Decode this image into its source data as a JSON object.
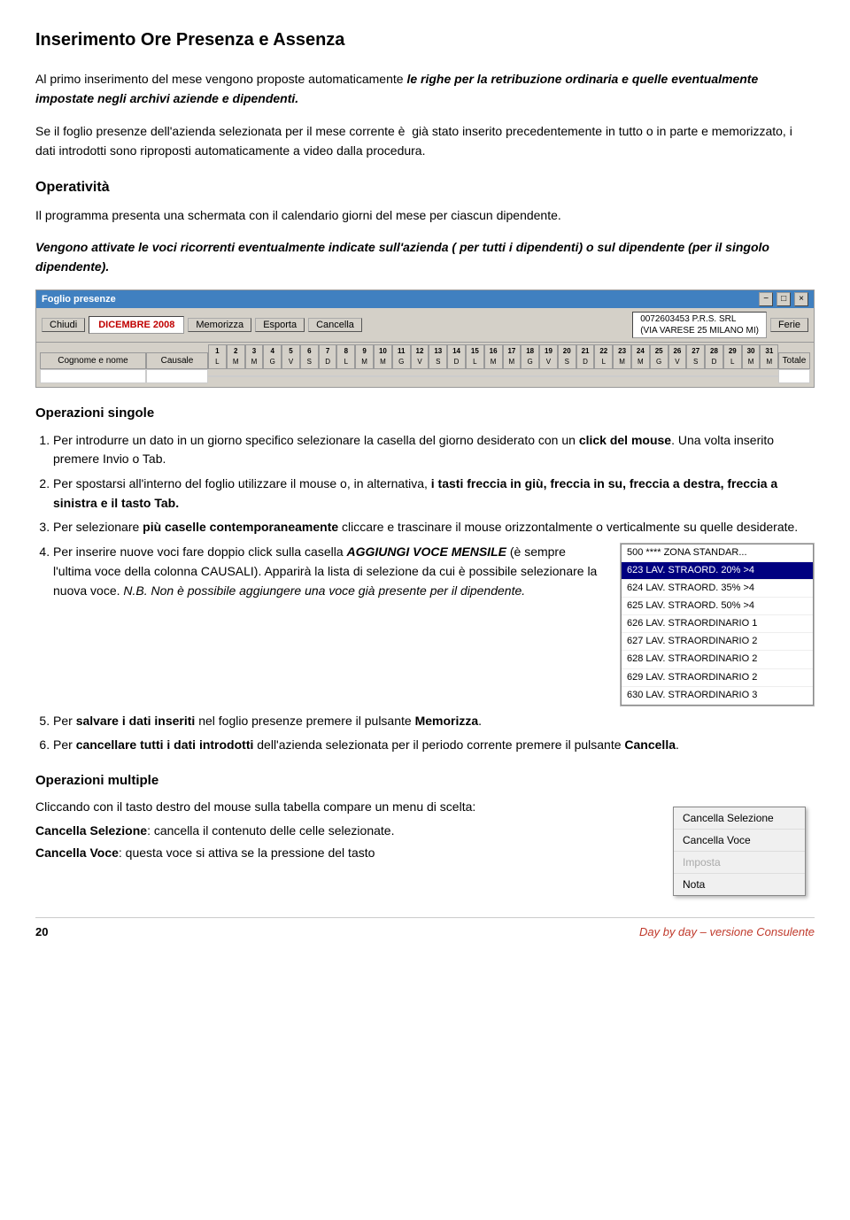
{
  "page": {
    "title": "Inserimento Ore Presenza e Assenza",
    "footer_page": "20",
    "footer_product": "Day by day – versione Consulente"
  },
  "paragraphs": {
    "intro": "Al primo inserimento del mese vengono proposte automaticamente le righe per la retribuzione ordinaria e quelle eventualmente impostate negli archivi aziende e dipendenti.",
    "foglio": "Se il foglio presenze dell'azienda selezionata per il mese corrente è  già stato inserito precedentemente in tutto o in parte e memorizzato, i dati introdotti sono riproposti automaticamente a video dalla procedura.",
    "operativita_heading": "Operatività",
    "operativita_body": "Il programma presenta una schermata con il calendario giorni del mese per ciascun dipendente.",
    "vengono": "Vengono attivate le voci ricorrenti eventualmente indicate sull'azienda ( per tutti i dipendenti) o sul dipendente (per il singolo dipendente).",
    "ops_singole_heading": "Operazioni singole",
    "op1": "Per introdurre un dato in un giorno specifico selezionare la casella del giorno desiderato con un click del mouse. Una volta inserito premere Invio o Tab.",
    "op2": "Per spostarsi all'interno del foglio utilizzare il mouse o, in alternativa, i tasti freccia in giù, freccia in su, freccia a destra, freccia a sinistra e il tasto Tab.",
    "op3": "Per selezionare più caselle contemporaneamente cliccare e trascinare il mouse orizzontalmente o verticalmente su quelle desiderate.",
    "op4_a": "Per inserire nuove voci fare doppio click sulla casella ",
    "op4_b": "AGGIUNGI VOCE MENSILE",
    "op4_c": " (è sempre l'ultima voce della colonna CAUSALI). Apparirà la lista di selezione da cui è possibile selezionare la nuova voce. ",
    "op4_nb": "N.B. Non è possibile aggiungere una voce già presente per il dipendente.",
    "op5": "Per salvare i dati inseriti nel foglio presenze premere il pulsante Memorizza.",
    "op6": "Per cancellare tutti i dati introdotti dell'azienda selezionata per il periodo corrente premere il pulsante Cancella.",
    "ops_multiple_heading": "Operazioni multiple",
    "ops_multiple_body": "Cliccando con il tasto destro del mouse sulla tabella compare un menu di scelta:",
    "cancella_selezione_label": "Cancella Selezione",
    "cancella_selezione_desc": ": cancella il contenuto delle celle selezionate.",
    "cancella_voce_label": "Cancella Voce",
    "cancella_voce_desc": ": questa voce si attiva se la pressione del tasto"
  },
  "foglio_ui": {
    "titlebar": "Foglio presenze",
    "titlebar_btns": [
      "-",
      "□",
      "×"
    ],
    "chiudi_label": "Chiudi",
    "month_label": "DICEMBRE 2008",
    "memorizza_label": "Memorizza",
    "esporta_label": "Esporta",
    "cancella_label": "Cancella",
    "company_line1": "0072603453  P.R.S. SRL",
    "company_line2": "(VIA VARESE 25 MILANO MI)",
    "ferie_label": "Ferie",
    "col_name": "Cognome e nome",
    "col_causale": "Causale",
    "col_total": "Totale",
    "days": [
      "1",
      "2",
      "3",
      "4",
      "5",
      "6",
      "7",
      "8",
      "9",
      "10",
      "11",
      "12",
      "13",
      "14",
      "15",
      "16",
      "17",
      "18",
      "19",
      "20",
      "21",
      "22",
      "23",
      "24",
      "25",
      "26",
      "27",
      "28",
      "29",
      "30",
      "31"
    ],
    "day_letters": [
      "L",
      "M",
      "M",
      "G",
      "V",
      "S",
      "D",
      "L",
      "M",
      "M",
      "G",
      "V",
      "S",
      "D",
      "L",
      "M",
      "M",
      "G",
      "V",
      "S",
      "D",
      "L",
      "M",
      "M",
      "G",
      "V",
      "S",
      "D",
      "L",
      "M",
      "M"
    ]
  },
  "dropdown": {
    "items": [
      {
        "label": "500 **** ZONA STANDAR...",
        "selected": false
      },
      {
        "label": "623 LAV. STRAORD. 20% >4",
        "selected": true
      },
      {
        "label": "624 LAV. STRAORD. 35% >4",
        "selected": false
      },
      {
        "label": "625 LAV. STRAORD. 50% >4",
        "selected": false
      },
      {
        "label": "626 LAV. STRAORDINARIO 1",
        "selected": false
      },
      {
        "label": "627 LAV. STRAORDINARIO 2",
        "selected": false
      },
      {
        "label": "628 LAV. STRAORDINARIO 2",
        "selected": false
      },
      {
        "label": "629 LAV. STRAORDINARIO 2",
        "selected": false
      },
      {
        "label": "630 LAV. STRAORDINARIO 3",
        "selected": false
      }
    ]
  },
  "context_menu": {
    "items": [
      {
        "label": "Cancella Selezione",
        "disabled": false
      },
      {
        "label": "Cancella Voce",
        "disabled": false
      },
      {
        "label": "Imposta",
        "disabled": true
      },
      {
        "label": "Nota",
        "disabled": false
      }
    ]
  }
}
